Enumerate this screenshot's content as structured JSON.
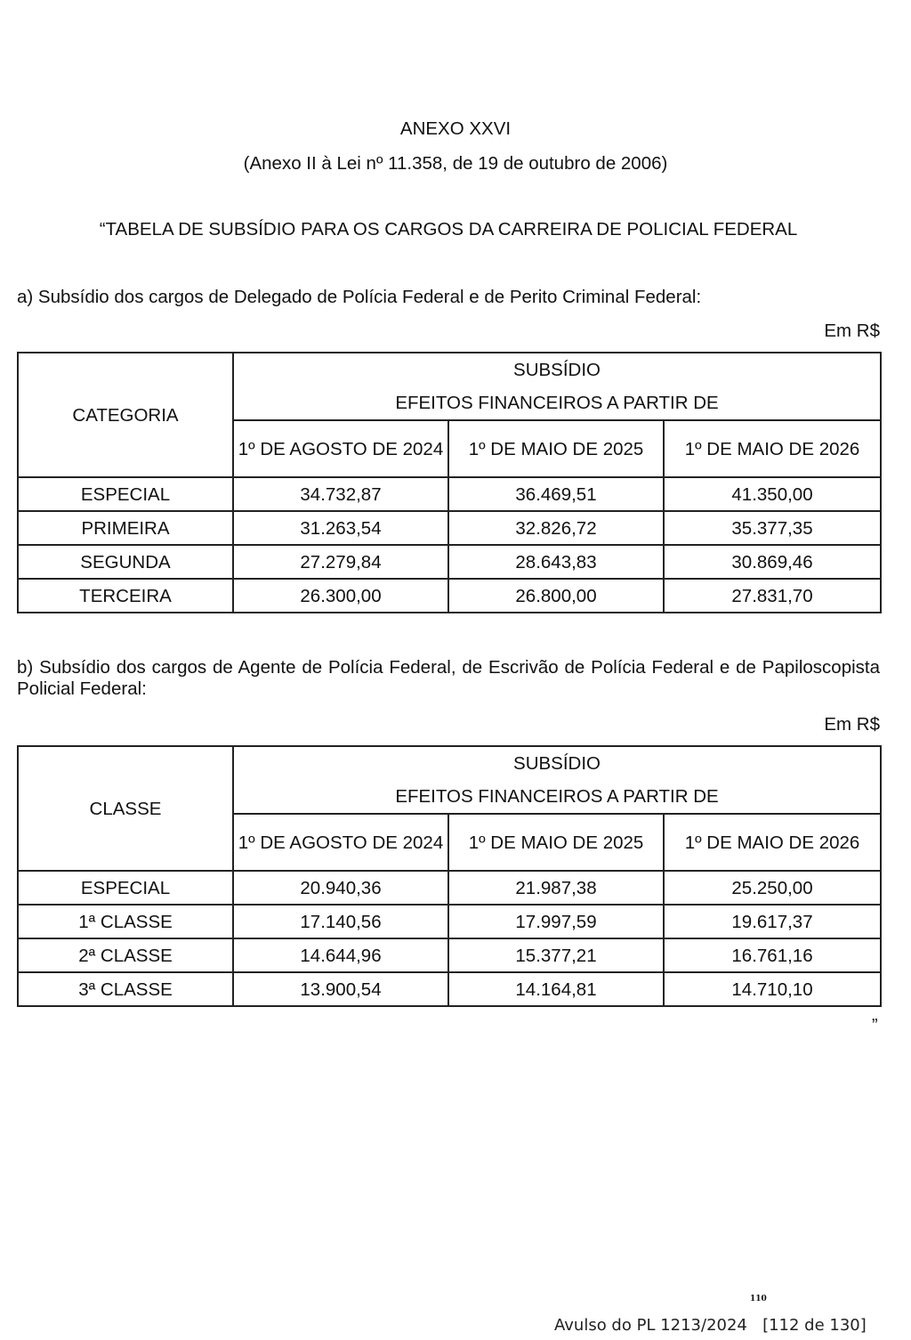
{
  "header": {
    "annex_title": "ANEXO XXVI",
    "annex_subtitle": "(Anexo II à Lei nº 11.358, de 19 de outubro de 2006)",
    "table_heading": "“TABELA DE SUBSÍDIO PARA OS CARGOS DA CARREIRA DE POLICIAL FEDERAL"
  },
  "section_a": {
    "intro": "a) Subsídio dos cargos de Delegado de Polícia Federal e de Perito Criminal Federal:",
    "unit": "Em R$",
    "first_col_header": "CATEGORIA",
    "group_header_line1": "SUBSÍDIO",
    "group_header_line2": "EFEITOS FINANCEIROS A PARTIR DE",
    "date_headers": [
      "1º DE AGOSTO DE 2024",
      "1º DE MAIO DE 2025",
      "1º DE MAIO DE 2026"
    ],
    "rows": [
      {
        "label": "ESPECIAL",
        "values": [
          "34.732,87",
          "36.469,51",
          "41.350,00"
        ]
      },
      {
        "label": "PRIMEIRA",
        "values": [
          "31.263,54",
          "32.826,72",
          "35.377,35"
        ]
      },
      {
        "label": "SEGUNDA",
        "values": [
          "27.279,84",
          "28.643,83",
          "30.869,46"
        ]
      },
      {
        "label": "TERCEIRA",
        "values": [
          "26.300,00",
          "26.800,00",
          "27.831,70"
        ]
      }
    ]
  },
  "section_b": {
    "intro": "b) Subsídio dos cargos de Agente de Polícia Federal, de Escrivão de Polícia Federal e de Papiloscopista Policial Federal:",
    "unit": "Em R$",
    "first_col_header": "CLASSE",
    "group_header_line1": "SUBSÍDIO",
    "group_header_line2": "EFEITOS FINANCEIROS A PARTIR DE",
    "date_headers": [
      "1º DE AGOSTO DE 2024",
      "1º DE MAIO DE 2025",
      "1º DE MAIO DE 2026"
    ],
    "rows": [
      {
        "label": "ESPECIAL",
        "values": [
          "20.940,36",
          "21.987,38",
          "25.250,00"
        ]
      },
      {
        "label": "1ª CLASSE",
        "values": [
          "17.140,56",
          "17.997,59",
          "19.617,37"
        ]
      },
      {
        "label": "2ª CLASSE",
        "values": [
          "14.644,96",
          "15.377,21",
          "16.761,16"
        ]
      },
      {
        "label": "3ª CLASSE",
        "values": [
          "13.900,54",
          "14.164,81",
          "14.710,10"
        ]
      }
    ]
  },
  "closing_quote": "”",
  "footer": {
    "page_number": "110",
    "avulso_text": "Avulso do PL 1213/2024",
    "page_indicator": "[112 de 130]"
  }
}
